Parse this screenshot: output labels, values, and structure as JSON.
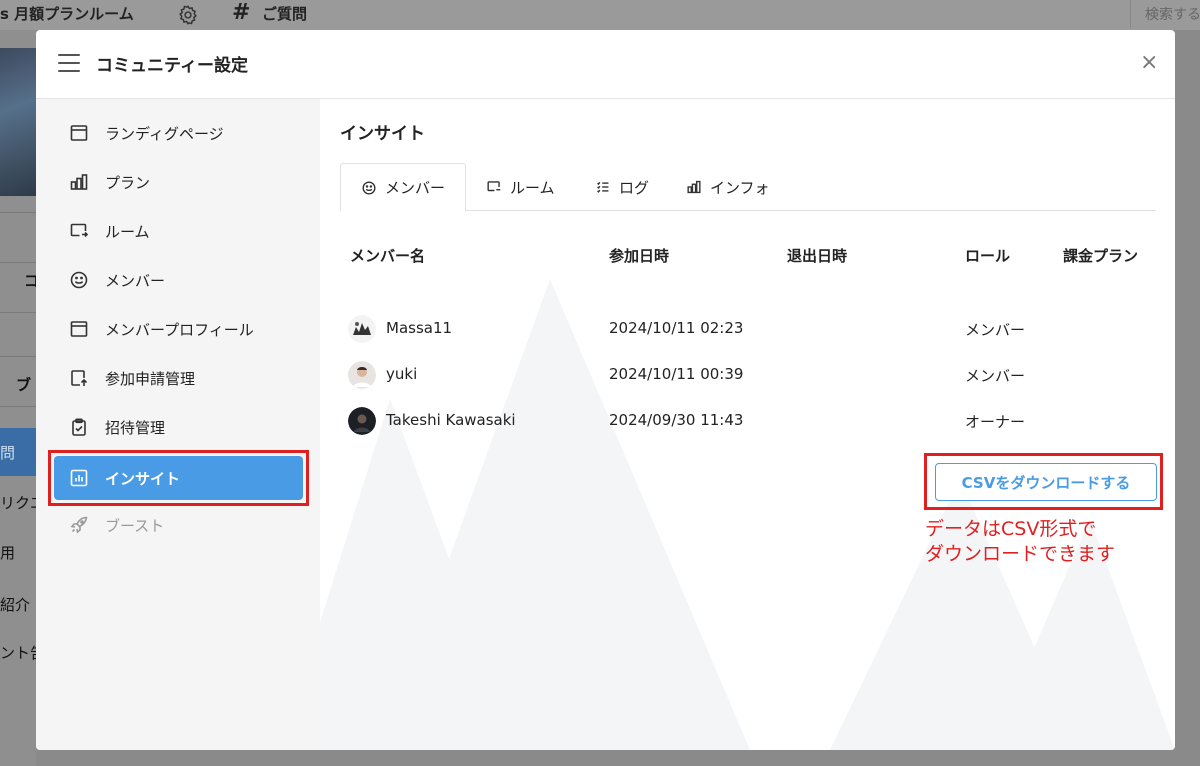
{
  "background": {
    "community_name": "s 月額プランルーム",
    "room_name": "ご質問",
    "search_placeholder": "検索する",
    "side_labels": [
      "コ",
      "ブ",
      "問",
      "リクエ",
      "用",
      "紹介",
      "ント告"
    ]
  },
  "modal": {
    "title": "コミュニティー設定",
    "close_label": "×"
  },
  "sidebar": {
    "items": [
      {
        "label": "ランディグページ",
        "icon": "browser-window-icon"
      },
      {
        "label": "プラン",
        "icon": "bar-chart-icon"
      },
      {
        "label": "ルーム",
        "icon": "room-screen-icon"
      },
      {
        "label": "メンバー",
        "icon": "smiley-face-icon"
      },
      {
        "label": "メンバープロフィール",
        "icon": "profile-window-icon"
      },
      {
        "label": "参加申請管理",
        "icon": "request-upload-icon"
      },
      {
        "label": "招待管理",
        "icon": "clipboard-check-icon"
      },
      {
        "label": "インサイト",
        "icon": "insight-chart-icon"
      },
      {
        "label": "ブースト",
        "icon": "rocket-icon"
      }
    ]
  },
  "content": {
    "title": "インサイト",
    "tabs": [
      {
        "label": "メンバー",
        "icon": "smiley-face-icon"
      },
      {
        "label": "ルーム",
        "icon": "room-screen-icon"
      },
      {
        "label": "ログ",
        "icon": "list-icon"
      },
      {
        "label": "インフォ",
        "icon": "bar-chart-icon"
      }
    ],
    "table": {
      "headers": [
        "メンバー名",
        "参加日時",
        "退出日時",
        "ロール",
        "課金プラン"
      ],
      "rows": [
        {
          "name": "Massa11",
          "joined": "2024/10/11 02:23",
          "left": "",
          "role": "メンバー",
          "plan": ""
        },
        {
          "name": "yuki",
          "joined": "2024/10/11 00:39",
          "left": "",
          "role": "メンバー",
          "plan": ""
        },
        {
          "name": "Takeshi Kawasaki",
          "joined": "2024/09/30 11:43",
          "left": "",
          "role": "オーナー",
          "plan": ""
        }
      ]
    },
    "csv_button": "CSVをダウンロードする",
    "annotation": [
      "データはCSV形式で",
      "ダウンロードできます"
    ]
  },
  "colors": {
    "accent": "#4a9be6",
    "highlight": "#e02020",
    "sidebar_bg": "#f5f5f6"
  }
}
